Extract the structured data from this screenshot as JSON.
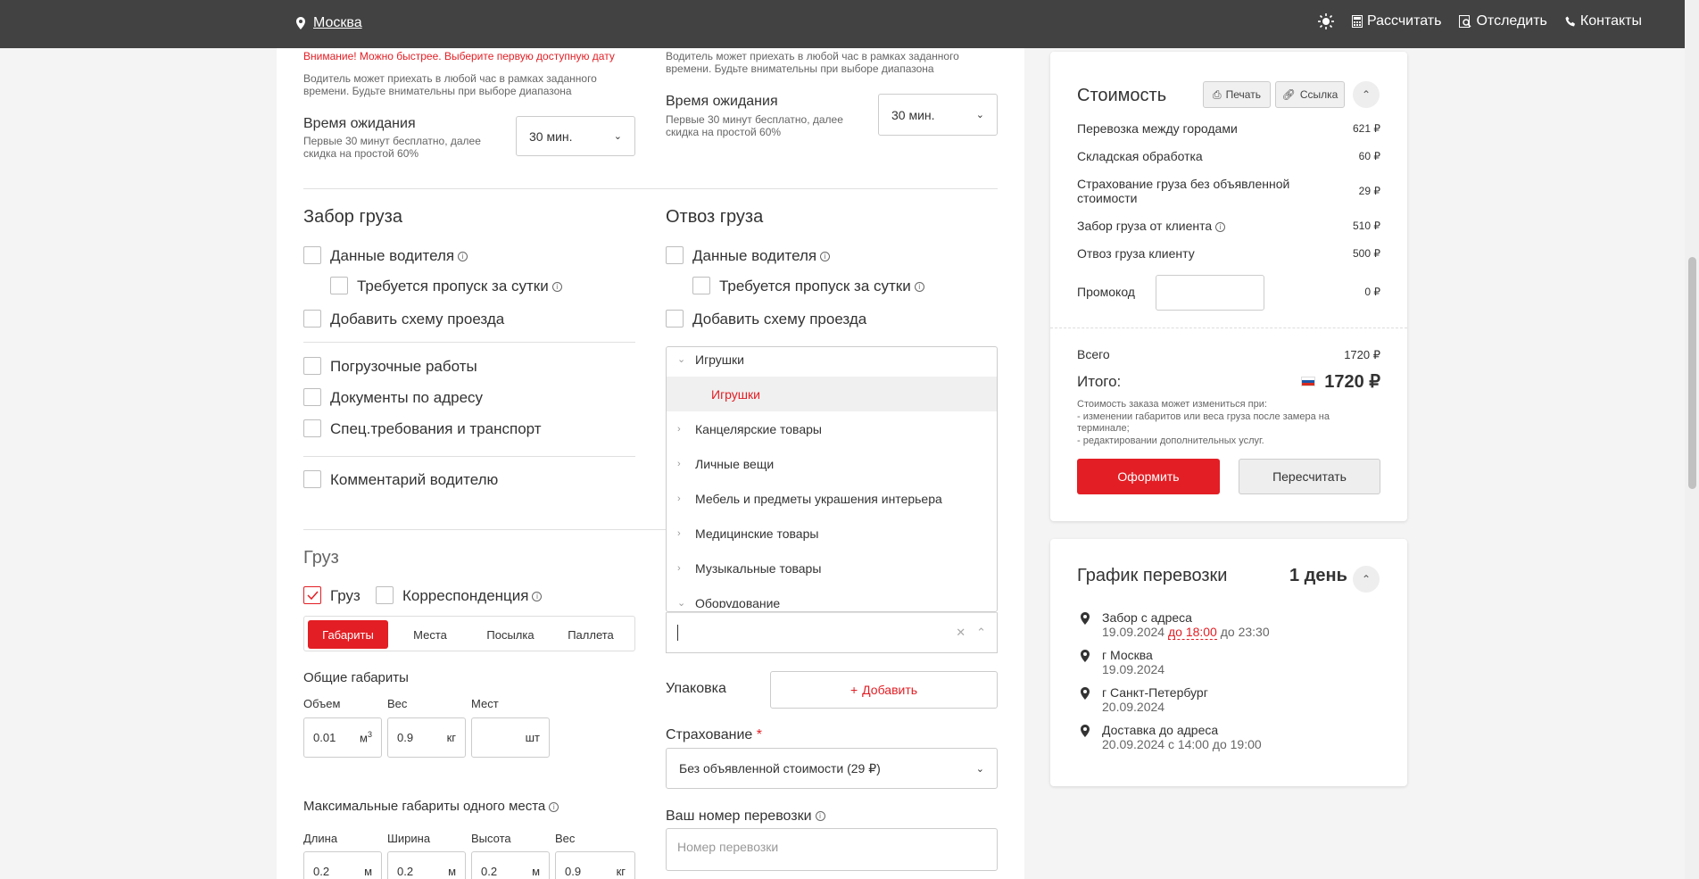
{
  "topbar": {
    "city": "Москва",
    "nav": [
      "Рассчитать",
      "Отследить",
      "Контакты"
    ]
  },
  "top_left": {
    "warning": "Внимание! Можно быстрее. Выберите первую доступную дату",
    "driver_note": "Водитель может приехать в любой час в рамках заданного времени. Будьте внимательны при выборе диапазона",
    "wait_title": "Время ожидания",
    "wait_note": "Первые 30 минут бесплатно, далее скидка на простой 60%",
    "wait_value": "30 мин."
  },
  "top_right": {
    "driver_note": "Водитель может приехать в любой час в рамках заданного времени. Будьте внимательны при выборе диапазона",
    "wait_title": "Время ожидания",
    "wait_note": "Первые 30 минут бесплатно, далее скидка на простой 60%",
    "wait_value": "30 мин."
  },
  "pickup": {
    "title": "Забор груза",
    "driver_data": "Данные водителя",
    "pass": "Требуется пропуск за сутки",
    "scheme": "Добавить схему проезда",
    "loading": "Погрузочные работы",
    "docs": "Документы по адресу",
    "special": "Спец.требования и транспорт",
    "comment": "Комментарий водителю"
  },
  "delivery": {
    "title": "Отвоз груза",
    "driver_data": "Данные водителя",
    "pass": "Требуется пропуск за сутки",
    "scheme": "Добавить схему проезда"
  },
  "category_dropdown": {
    "items": [
      {
        "label": "Игрушки",
        "expanded": true
      },
      {
        "label": "Игрушки",
        "sub": true
      },
      {
        "label": "Канцелярские товары"
      },
      {
        "label": "Личные вещи"
      },
      {
        "label": "Мебель и предметы украшения интерьера"
      },
      {
        "label": "Медицинские товары"
      },
      {
        "label": "Музыкальные товары"
      },
      {
        "label": "Оборудование",
        "expanded": true
      }
    ],
    "input_value": ""
  },
  "cargo": {
    "title": "Груз",
    "type_cargo": "Груз",
    "type_mail": "Корреспонденция",
    "tabs": [
      "Габариты",
      "Места",
      "Посылка",
      "Паллета"
    ],
    "general_title": "Общие габариты",
    "volume_label": "Объем",
    "volume_value": "0.01",
    "volume_unit": "м",
    "weight_label": "Вес",
    "weight_value": "0.9",
    "weight_unit": "кг",
    "places_label": "Мест",
    "places_value": "",
    "places_unit": "шт",
    "max_title": "Максимальные габариты одного места",
    "length_label": "Длина",
    "length_value": "0.2",
    "length_unit": "м",
    "width_label": "Ширина",
    "width_value": "0.2",
    "width_unit": "м",
    "height_label": "Высота",
    "height_value": "0.2",
    "height_unit": "м",
    "weight2_label": "Вес",
    "weight2_value": "0.9",
    "weight2_unit": "кг"
  },
  "packing": {
    "label": "Упаковка",
    "add": "Добавить"
  },
  "insurance": {
    "label": "Страхование",
    "required": "*",
    "value": "Без объявленной стоимости (29 ₽)"
  },
  "tracking": {
    "label": "Ваш номер перевозки",
    "placeholder": "Номер перевозки"
  },
  "cost": {
    "title": "Стоимость",
    "print": "Печать",
    "link": "Ссылка",
    "rows": [
      {
        "label": "Перевозка между городами",
        "value": "621 ₽"
      },
      {
        "label": "Складская обработка",
        "value": "60 ₽"
      },
      {
        "label": "Страхование груза без объявленной стоимости",
        "value": "29 ₽"
      },
      {
        "label": "Забор груза от клиента",
        "value": "510 ₽"
      },
      {
        "label": "Отвоз груза клиенту",
        "value": "500 ₽"
      }
    ],
    "promo_label": "Промокод",
    "promo_value": "0 ₽",
    "total_label": "Всего",
    "total_value": "1720 ₽",
    "final_label": "Итого:",
    "final_value": "1720 ₽",
    "note": "Стоимость заказа может измениться при:\n- изменении габаритов или веса груза после замера на терминале;\n- редактировании дополнительных услуг.",
    "order": "Оформить",
    "recalc": "Пересчитать"
  },
  "schedule": {
    "title": "График перевозки",
    "days": "1 день",
    "steps": [
      {
        "title": "Забор с адреса",
        "date": "19.09.2024",
        "time_a": "до 18:00",
        "time_b": "до 23:30"
      },
      {
        "title": "г Москва",
        "date": "19.09.2024"
      },
      {
        "title": "г Санкт-Петербург",
        "date": "20.09.2024"
      },
      {
        "title": "Доставка до адреса",
        "date": "20.09.2024 с 14:00 до 19:00"
      }
    ]
  },
  "colors": {
    "accent": "#e31e24",
    "topbar": "#424242"
  }
}
